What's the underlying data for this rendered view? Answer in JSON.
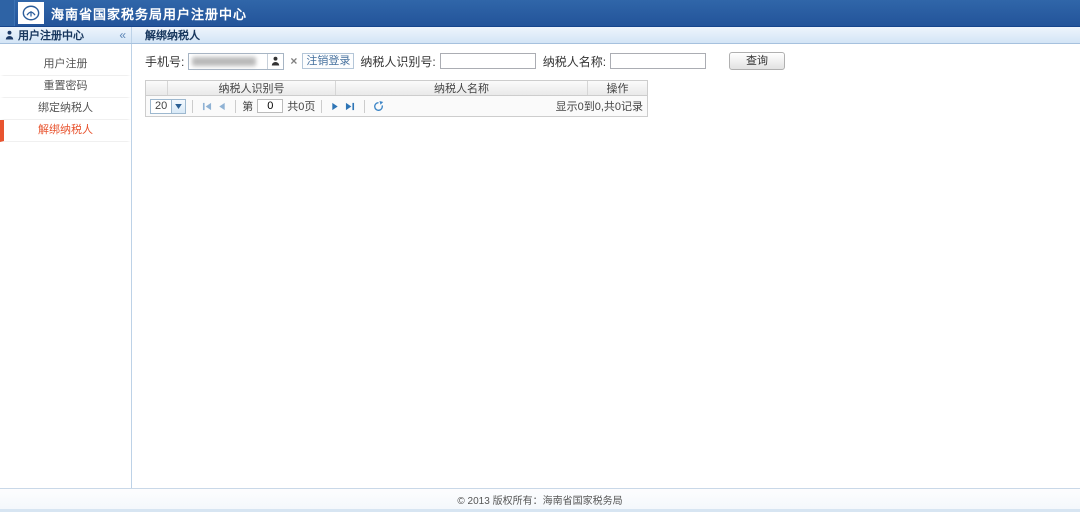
{
  "header": {
    "title": "海南省国家税务局用户注册中心"
  },
  "sidebar": {
    "title": "用户注册中心",
    "collapse_glyph": "«",
    "items": [
      {
        "label": "用户注册",
        "active": false
      },
      {
        "label": "重置密码",
        "active": false
      },
      {
        "label": "绑定纳税人",
        "active": false
      },
      {
        "label": "解绑纳税人",
        "active": true
      }
    ]
  },
  "tab": {
    "label": "解绑纳税人"
  },
  "form": {
    "phone": {
      "label": "手机号:",
      "masked": true
    },
    "clear_glyph": "×",
    "logout_label": "注销登录",
    "taxpayer_id": {
      "label": "纳税人识别号:",
      "value": ""
    },
    "taxpayer_name": {
      "label": "纳税人名称:",
      "value": ""
    },
    "query_label": "查询"
  },
  "table": {
    "columns": [
      "",
      "纳税人识别号",
      "纳税人名称",
      "操作"
    ],
    "rows": []
  },
  "pagination": {
    "page_size": "20",
    "page_prefix": "第",
    "current_page": "0",
    "total_pages_label": "共0页",
    "summary": "显示0到0,共0记录"
  },
  "footer": {
    "copyright": "© 2013 版权所有：海南省国家税务局"
  },
  "colors": {
    "header_blue": "#24549A",
    "subbar_blue": "#D3E5F6",
    "active_accent": "#E8542F",
    "link_blue": "#46719E"
  }
}
